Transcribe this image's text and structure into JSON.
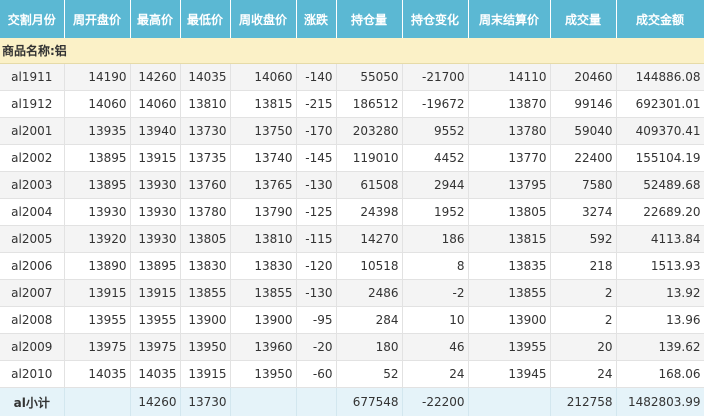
{
  "headers": [
    "交割月份",
    "周开盘价",
    "最高价",
    "最低价",
    "周收盘价",
    "涨跌",
    "持仓量",
    "持仓变化",
    "周末结算价",
    "成交量",
    "成交金额"
  ],
  "group_label": "商品名称:铝",
  "rows": [
    [
      "al1911",
      "14190",
      "14260",
      "14035",
      "14060",
      "-140",
      "55050",
      "-21700",
      "14110",
      "20460",
      "144886.08"
    ],
    [
      "al1912",
      "14060",
      "14060",
      "13810",
      "13815",
      "-215",
      "186512",
      "-19672",
      "13870",
      "99146",
      "692301.01"
    ],
    [
      "al2001",
      "13935",
      "13940",
      "13730",
      "13750",
      "-170",
      "203280",
      "9552",
      "13780",
      "59040",
      "409370.41"
    ],
    [
      "al2002",
      "13895",
      "13915",
      "13735",
      "13740",
      "-145",
      "119010",
      "4452",
      "13770",
      "22400",
      "155104.19"
    ],
    [
      "al2003",
      "13895",
      "13930",
      "13760",
      "13765",
      "-130",
      "61508",
      "2944",
      "13795",
      "7580",
      "52489.68"
    ],
    [
      "al2004",
      "13930",
      "13930",
      "13780",
      "13790",
      "-125",
      "24398",
      "1952",
      "13805",
      "3274",
      "22689.20"
    ],
    [
      "al2005",
      "13920",
      "13930",
      "13805",
      "13810",
      "-115",
      "14270",
      "186",
      "13815",
      "592",
      "4113.84"
    ],
    [
      "al2006",
      "13890",
      "13895",
      "13830",
      "13830",
      "-120",
      "10518",
      "8",
      "13835",
      "218",
      "1513.93"
    ],
    [
      "al2007",
      "13915",
      "13915",
      "13855",
      "13855",
      "-130",
      "2486",
      "-2",
      "13855",
      "2",
      "13.92"
    ],
    [
      "al2008",
      "13955",
      "13955",
      "13900",
      "13900",
      "-95",
      "284",
      "10",
      "13900",
      "2",
      "13.96"
    ],
    [
      "al2009",
      "13975",
      "13975",
      "13950",
      "13960",
      "-20",
      "180",
      "46",
      "13955",
      "20",
      "139.62"
    ],
    [
      "al2010",
      "14035",
      "14035",
      "13915",
      "13950",
      "-60",
      "52",
      "24",
      "13945",
      "24",
      "168.06"
    ]
  ],
  "subtotal": [
    "al小计",
    "",
    "14260",
    "13730",
    "",
    "",
    "677548",
    "-22200",
    "",
    "212758",
    "1482803.99"
  ],
  "colors": {
    "header_bg": "#5bb8d3",
    "group_bg": "#fbf1c7",
    "subtotal_bg": "#e5f3f9"
  }
}
